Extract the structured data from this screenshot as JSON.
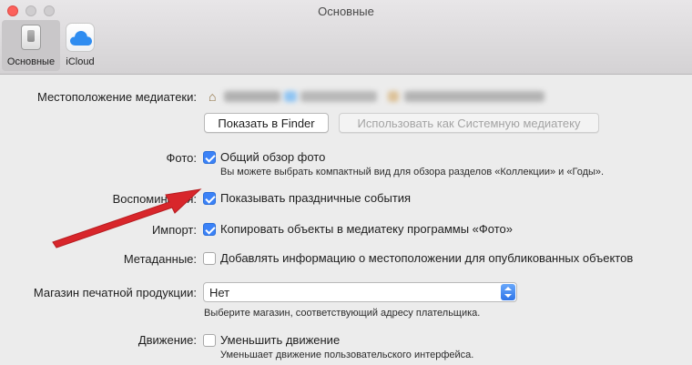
{
  "window": {
    "title": "Основные"
  },
  "toolbar": {
    "items": [
      {
        "label": "Основные",
        "icon": "general-switch-icon",
        "active": true
      },
      {
        "label": "iCloud",
        "icon": "icloud-icon",
        "active": false
      }
    ]
  },
  "library": {
    "label": "Местоположение медиатеки:",
    "home_icon": "home-icon",
    "show_in_finder": "Показать в Finder",
    "use_as_system": "Использовать как Системную медиатеку"
  },
  "photos": {
    "label": "Фото:",
    "option": "Общий обзор фото",
    "checked": true,
    "hint": "Вы можете выбрать компактный вид для обзора разделов «Коллекции» и «Годы»."
  },
  "memories": {
    "label": "Воспоминания:",
    "option": "Показывать праздничные события",
    "checked": true
  },
  "import": {
    "label": "Импорт:",
    "option": "Копировать объекты в медиатеку программы «Фото»",
    "checked": true
  },
  "metadata": {
    "label": "Метаданные:",
    "option": "Добавлять информацию о местоположении для опубликованных объектов",
    "checked": false
  },
  "print_store": {
    "label": "Магазин печатной продукции:",
    "selected": "Нет",
    "hint": "Выберите магазин, соответствующий адресу плательщика."
  },
  "motion": {
    "label": "Движение:",
    "option": "Уменьшить движение",
    "checked": false,
    "hint": "Уменьшает движение пользовательского интерфейса."
  },
  "colors": {
    "accent": "#3b82f7",
    "arrow": "#d8262b",
    "close_button": "#fc605b"
  }
}
